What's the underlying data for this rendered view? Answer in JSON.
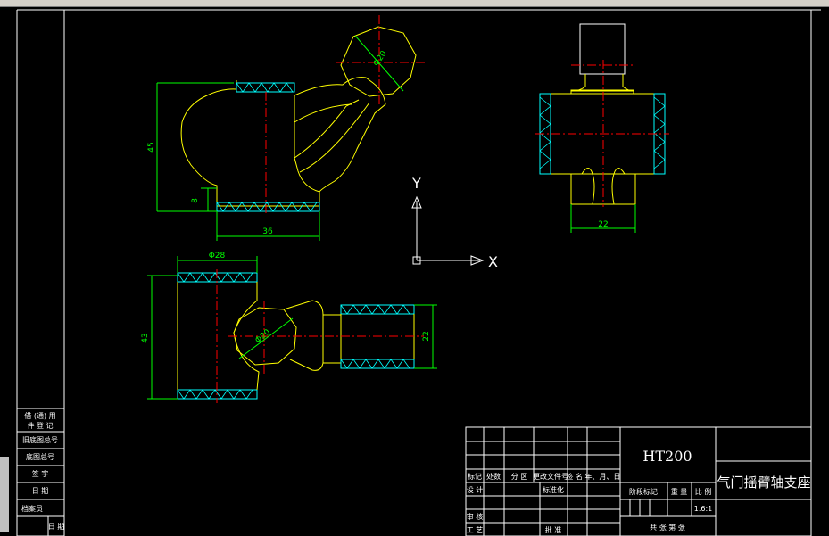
{
  "drawing": {
    "material": "HT200",
    "part_name": "气门摇臂轴支座",
    "scale": "1.6:1"
  },
  "dimensions": {
    "top_view_height": "45",
    "top_view_step": "8",
    "top_view_width": "36",
    "top_view_circle_dia": "Φ20",
    "side_view_width": "22",
    "bottom_view_top_dia": "Φ28",
    "bottom_view_height": "43",
    "bottom_view_circle_dia": "Φ20",
    "bottom_view_right_dia": "22"
  },
  "ucs": {
    "y_label": "Y",
    "x_label": "X"
  },
  "left_table": {
    "r1": "借 (通) 用",
    "r2": "件 登 记",
    "r3": "旧底图总号",
    "r4": "底图总号",
    "r5": "签 字",
    "r6": "日 期",
    "r7": "档案员",
    "r8": "日 期"
  },
  "title_block": {
    "mark": "标记",
    "count": "处数",
    "zone": "分 区",
    "change_doc": "更改文件号",
    "sign_date": "签 名 年、月、日",
    "design": "设 计",
    "standardize": "标准化",
    "check": "审 核",
    "process": "工 艺",
    "approve": "批 准",
    "stage_mark": "阶段标记",
    "weight": "重 量",
    "ratio": "比 例",
    "sheets_total": "共 张 第 张"
  },
  "colors": {
    "outline": "#ffffff",
    "part": "#ffff00",
    "centerline": "#ff0000",
    "dimension": "#00ff00",
    "hatch": "#00ffff"
  }
}
